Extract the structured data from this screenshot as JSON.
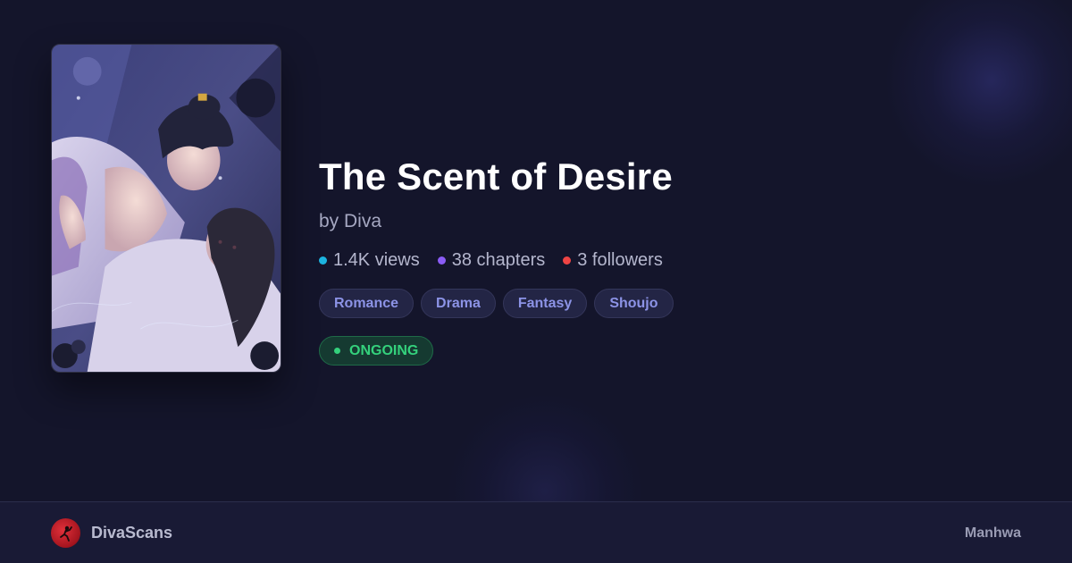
{
  "series": {
    "title": "The Scent of Desire",
    "byline": "by Diva",
    "cover_alt": "The Scent of Desire cover art"
  },
  "stats": [
    {
      "value": "1.4K views",
      "color": "#1cb4e0"
    },
    {
      "value": "38 chapters",
      "color": "#8b5cf6"
    },
    {
      "value": "3 followers",
      "color": "#ef4444"
    }
  ],
  "tags": [
    "Romance",
    "Drama",
    "Fantasy",
    "Shoujo"
  ],
  "status": {
    "label": "ONGOING",
    "color": "#34d17c"
  },
  "footer": {
    "brand": "DivaScans",
    "type": "Manhwa"
  },
  "colors": {
    "background": "#14152b",
    "tag_text": "#8c93e6"
  }
}
